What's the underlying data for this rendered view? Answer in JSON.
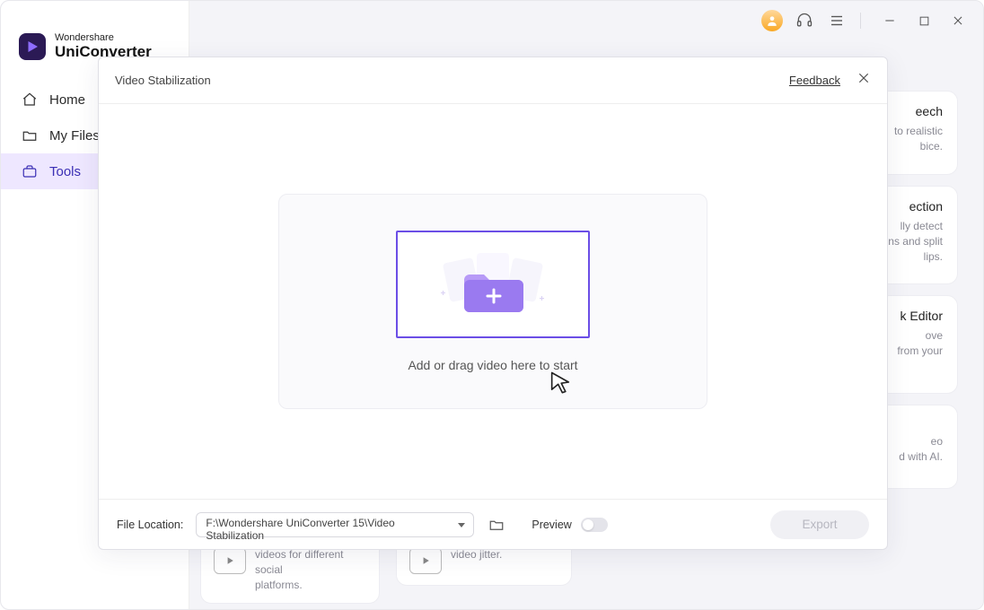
{
  "brand": {
    "small": "Wondershare",
    "big": "UniConverter"
  },
  "sidebar": {
    "items": [
      {
        "label": "Home"
      },
      {
        "label": "My Files"
      },
      {
        "label": "Tools"
      }
    ]
  },
  "bgCards": {
    "c1": {
      "title_tail": "eech",
      "l1": "to realistic",
      "l2": "bice."
    },
    "c2": {
      "title_tail": "ection",
      "l1": "lly detect",
      "l2": "tions and split",
      "l3": "lips."
    },
    "c3": {
      "title_tail": "k Editor",
      "l1": "ove",
      "l2": "from your"
    },
    "c4": {
      "l1": "eo",
      "l2": "d with AI."
    }
  },
  "bgTools": {
    "t1": {
      "l1": "videos for different social",
      "l2": "platforms."
    },
    "t2": {
      "l1": "video jitter."
    }
  },
  "modal": {
    "title": "Video Stabilization",
    "feedback": "Feedback",
    "drop_prompt": "Add or drag video here to start",
    "footer": {
      "file_label": "File Location:",
      "file_value": "F:\\Wondershare UniConverter 15\\Video Stabilization",
      "preview_label": "Preview",
      "export_label": "Export"
    }
  }
}
